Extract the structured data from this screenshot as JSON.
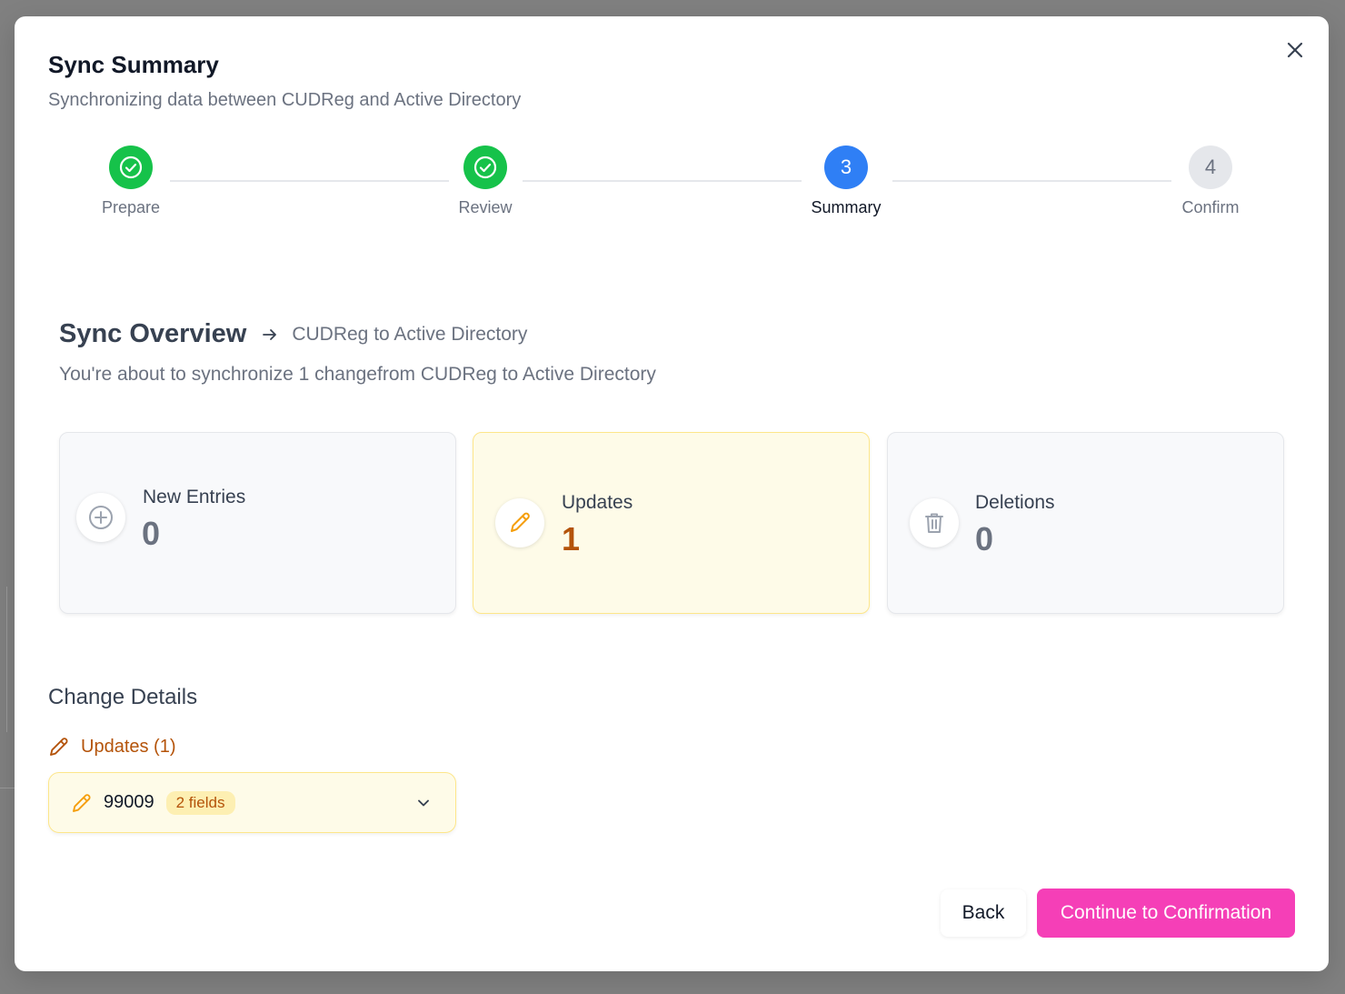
{
  "dialog": {
    "title": "Sync Summary",
    "subtitle": "Synchronizing data between CUDReg and Active Directory",
    "close_icon": "close-icon"
  },
  "stepper": {
    "steps": [
      {
        "number": "1",
        "label": "Prepare",
        "state": "done"
      },
      {
        "number": "2",
        "label": "Review",
        "state": "done"
      },
      {
        "number": "3",
        "label": "Summary",
        "state": "current"
      },
      {
        "number": "4",
        "label": "Confirm",
        "state": "todo"
      }
    ],
    "colors": {
      "done": "#16c24a",
      "current": "#2f7ff5",
      "todo": "#e5e7eb"
    }
  },
  "overview": {
    "title": "Sync Overview",
    "direction": "CUDReg to Active Directory",
    "description": "You're about to synchronize 1 changefrom CUDReg to Active Directory"
  },
  "cards": {
    "new": {
      "label": "New Entries",
      "value": "0",
      "icon": "plus-circle-icon"
    },
    "updates": {
      "label": "Updates",
      "value": "1",
      "icon": "pencil-icon"
    },
    "deletions": {
      "label": "Deletions",
      "value": "0",
      "icon": "trash-icon"
    }
  },
  "details": {
    "title": "Change Details",
    "updates_heading": "Updates (1)",
    "items": [
      {
        "id": "99009",
        "badge": "2 fields"
      }
    ]
  },
  "footer": {
    "back_label": "Back",
    "continue_label": "Continue to Confirmation",
    "continue_color": "#f53fb7"
  }
}
